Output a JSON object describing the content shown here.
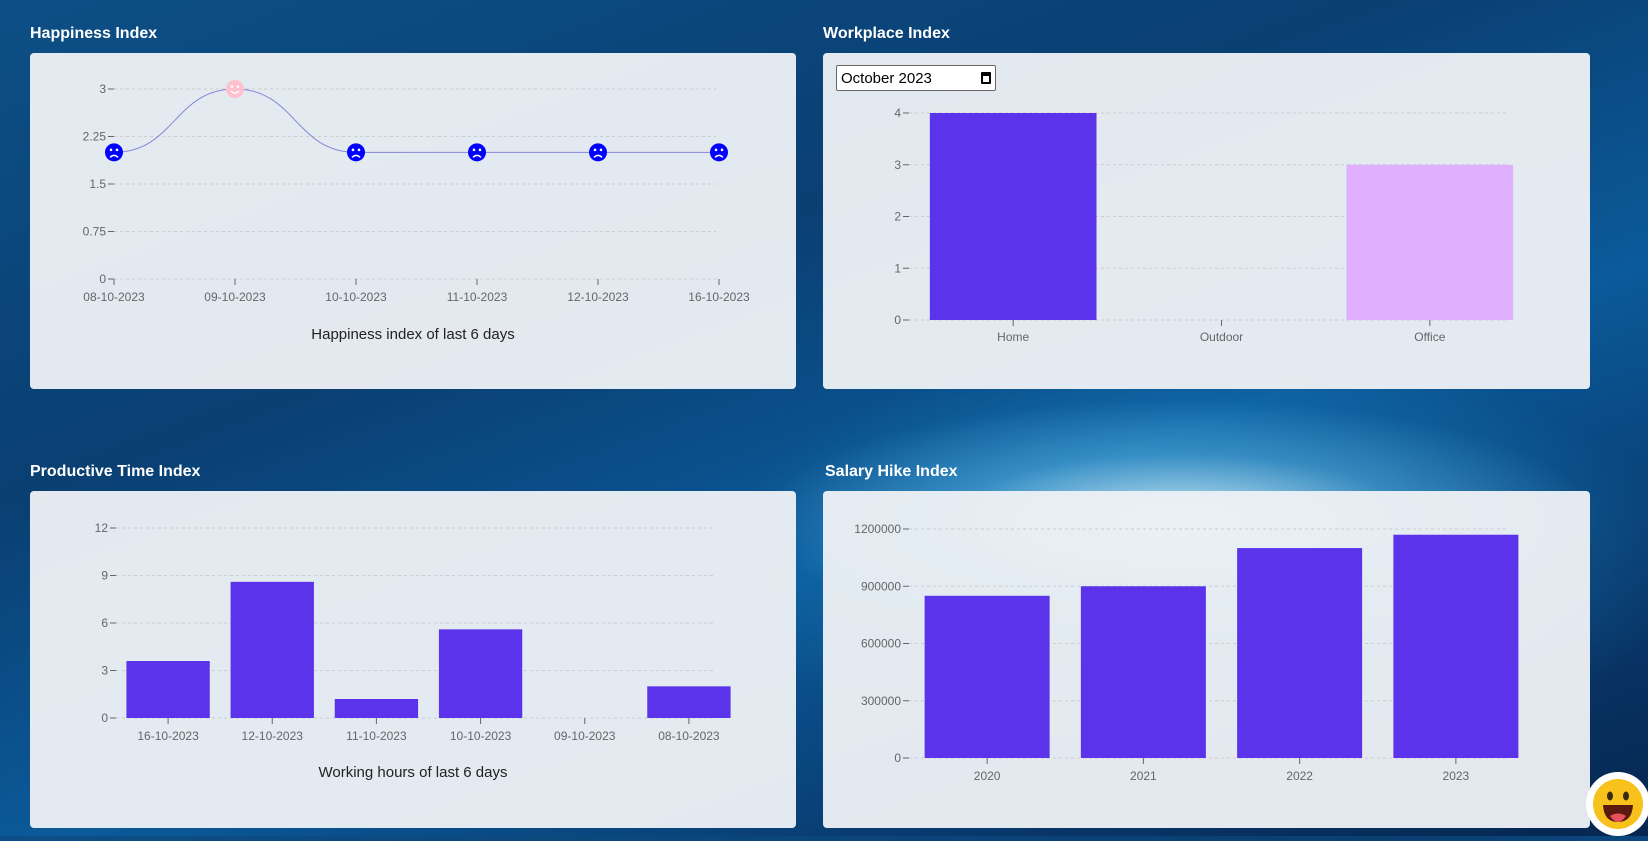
{
  "colors": {
    "bar": "#5b33ea",
    "office_bar": "#e0b0ff",
    "line": "#8884d8",
    "sad_marker": "#0000ff",
    "happy_marker": "#ffc0cb"
  },
  "happiness": {
    "title": "Happiness Index",
    "caption": "Happiness index of last 6 days"
  },
  "workplace": {
    "title": "Workplace Index",
    "month_value": "October 2023"
  },
  "productive": {
    "title": "Productive Time Index",
    "caption": "Working hours of last 6 days"
  },
  "salary": {
    "title": "Salary Hike Index"
  },
  "chart_data": [
    {
      "id": "happiness",
      "type": "line",
      "categories": [
        "08-10-2023",
        "09-10-2023",
        "10-10-2023",
        "11-10-2023",
        "12-10-2023",
        "16-10-2023"
      ],
      "values": [
        2,
        3,
        2,
        2,
        2,
        2
      ],
      "markers": [
        "sad",
        "happy",
        "sad",
        "sad",
        "sad",
        "sad"
      ],
      "yticks": [
        0,
        0.75,
        1.5,
        2.25,
        3
      ],
      "ylim": [
        0,
        3
      ],
      "grid": true,
      "xlabel": "Happiness index of last 6 days"
    },
    {
      "id": "workplace",
      "type": "bar",
      "categories": [
        "Home",
        "Outdoor",
        "Office"
      ],
      "values": [
        4,
        0,
        3
      ],
      "yticks": [
        0,
        1,
        2,
        3,
        4
      ],
      "ylim": [
        0,
        4
      ],
      "grid": true
    },
    {
      "id": "productive",
      "type": "bar",
      "categories": [
        "16-10-2023",
        "12-10-2023",
        "11-10-2023",
        "10-10-2023",
        "09-10-2023",
        "08-10-2023"
      ],
      "values": [
        3.6,
        8.6,
        1.2,
        5.6,
        0,
        2
      ],
      "yticks": [
        0,
        3,
        6,
        9,
        12
      ],
      "ylim": [
        0,
        12
      ],
      "grid": true,
      "xlabel": "Working hours of last 6 days"
    },
    {
      "id": "salary",
      "type": "bar",
      "categories": [
        "2020",
        "2021",
        "2022",
        "2023"
      ],
      "values": [
        850000,
        900000,
        1100000,
        1170000
      ],
      "yticks": [
        0,
        300000,
        600000,
        900000,
        1200000
      ],
      "ylim": [
        0,
        1200000
      ],
      "grid": true
    }
  ]
}
